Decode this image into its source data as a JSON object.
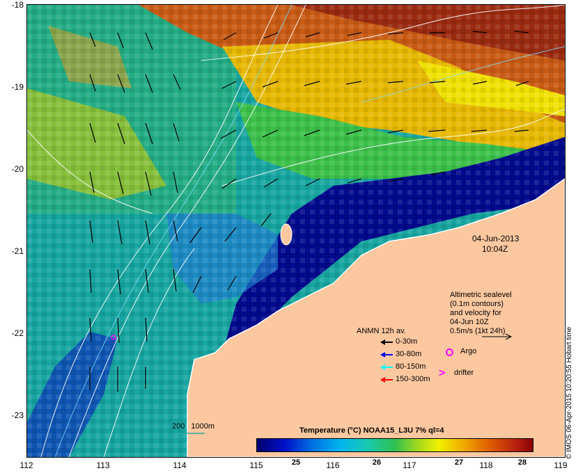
{
  "map": {
    "date": "04-Jun-2013",
    "time": "10:04Z",
    "x_ticks": [
      "112",
      "113",
      "114",
      "115",
      "116",
      "117",
      "118",
      "119"
    ],
    "y_ticks": [
      "-18",
      "-19",
      "-20",
      "-21",
      "-22",
      "-23"
    ],
    "altimetric_note": [
      "Altimetric sealevel",
      "(0.1m contours)",
      "and velocity for",
      "04-Jun 10Z",
      "0.5m/s (1kt 24h)"
    ],
    "anmn_title": "ANMN 12h av.",
    "anmn_depths": [
      {
        "label": "0-30m",
        "color": "#000000"
      },
      {
        "label": "30-80m",
        "color": "#0000ff"
      },
      {
        "label": "80-150m",
        "color": "#00ffff"
      },
      {
        "label": "150-300m",
        "color": "#ff0000"
      }
    ],
    "argo_label": "Argo",
    "drifter_label": "drifter",
    "scale_label": "200 1000m",
    "colorbar_title": "Temperature (°C) NOAA15_L3U 7% ql=4",
    "colorbar_ticks": [
      "25",
      "26",
      "27",
      "28"
    ],
    "credit": "© IMOS 06-Apr-2015 10:20:55 Hobart time",
    "colors": {
      "land": "#fdc8a0",
      "cold": "#000a8c",
      "argo": "#ff00ff"
    }
  }
}
